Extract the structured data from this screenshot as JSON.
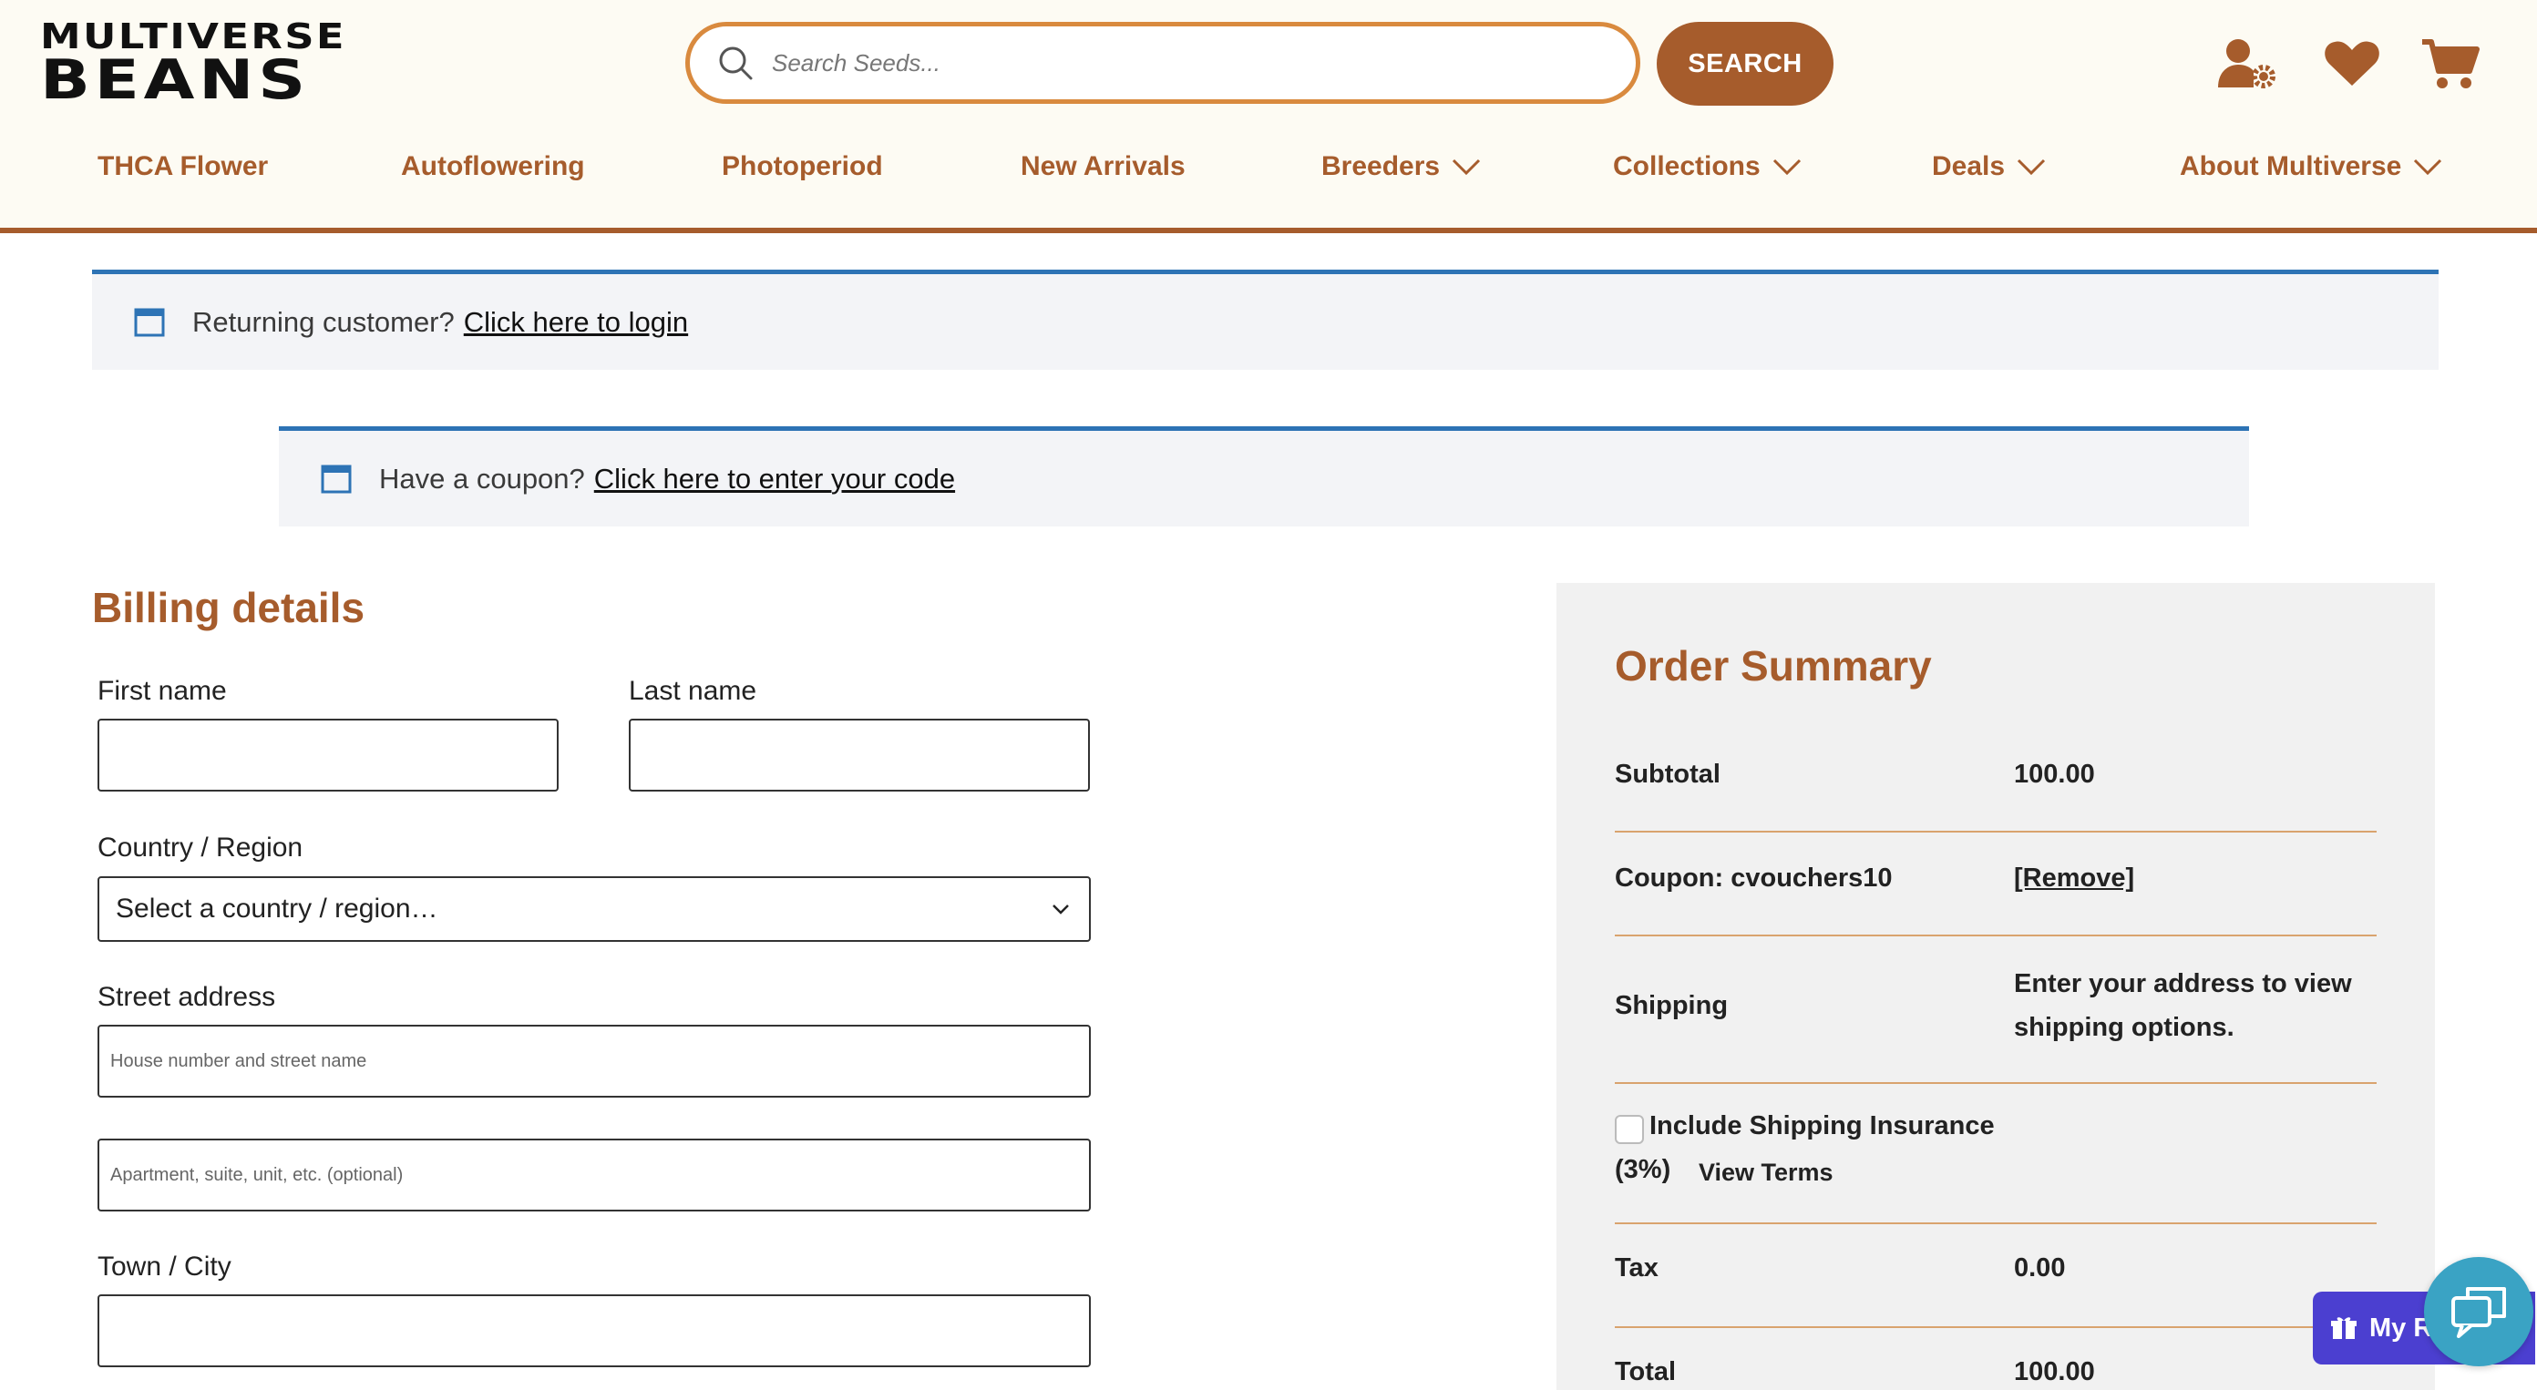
{
  "header": {
    "logo_line1": "MULTIVERSE",
    "logo_line2": "BEANS",
    "search_placeholder": "Search Seeds...",
    "search_button": "SEARCH",
    "icons": [
      "account-settings-icon",
      "heart-icon",
      "cart-icon"
    ]
  },
  "nav": {
    "items": [
      {
        "label": "THCA Flower",
        "has_dropdown": false
      },
      {
        "label": "Autoflowering",
        "has_dropdown": false
      },
      {
        "label": "Photoperiod",
        "has_dropdown": false
      },
      {
        "label": "New Arrivals",
        "has_dropdown": false
      },
      {
        "label": "Breeders",
        "has_dropdown": true
      },
      {
        "label": "Collections",
        "has_dropdown": true
      },
      {
        "label": "Deals",
        "has_dropdown": true
      },
      {
        "label": "About Multiverse",
        "has_dropdown": true
      }
    ]
  },
  "notices": {
    "login_text": "Returning customer?",
    "login_link": "Click here to login",
    "coupon_text": "Have a coupon?",
    "coupon_link": "Click here to enter your code"
  },
  "billing": {
    "title": "Billing details",
    "first_name_label": "First name",
    "last_name_label": "Last name",
    "country_label": "Country / Region",
    "country_value": "Select a country / region…",
    "street_label": "Street address",
    "street_placeholder": "House number and street name",
    "street2_placeholder": "Apartment, suite, unit, etc. (optional)",
    "city_label": "Town / City"
  },
  "summary": {
    "title": "Order Summary",
    "subtotal_label": "Subtotal",
    "subtotal_value": "100.00",
    "coupon_label": "Coupon: cvouchers10",
    "coupon_remove": "[Remove]",
    "shipping_label": "Shipping",
    "shipping_value_line1": "Enter your address to view",
    "shipping_value_line2": "shipping options.",
    "insurance_label": "Include Shipping Insurance",
    "insurance_pct": "(3%)",
    "view_terms": "View Terms",
    "tax_label": "Tax",
    "tax_value": "0.00",
    "total_label": "Total",
    "total_value": "100.00"
  },
  "widgets": {
    "rewards_label": "My R"
  },
  "colors": {
    "brand_brown": "#a65c2c",
    "search_border": "#d98a3e",
    "notice_blue": "#2d73b5",
    "header_bg": "#fdfbf3",
    "rewards_purple": "#4b3fd0",
    "chat_teal": "#3aa3c4"
  }
}
